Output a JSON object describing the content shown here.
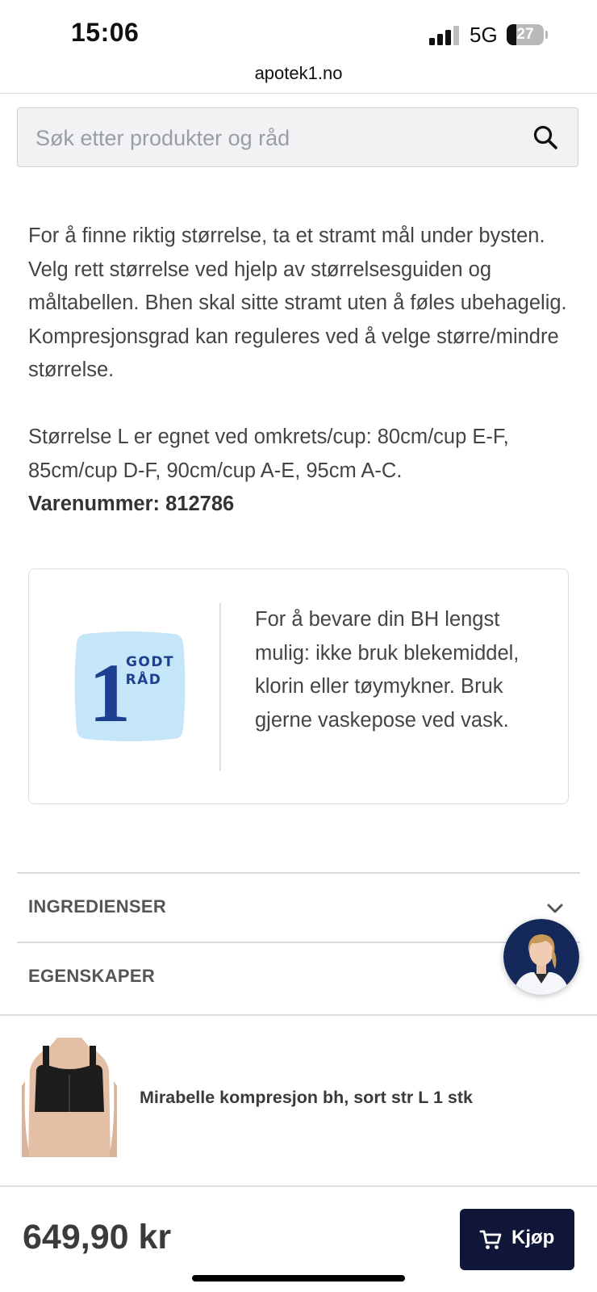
{
  "status_bar": {
    "time": "15:06",
    "network": "5G",
    "battery": "27",
    "battery_level": 0.27
  },
  "browser": {
    "url": "apotek1.no"
  },
  "search": {
    "placeholder": "Søk etter produkter og råd",
    "icon": "search-icon"
  },
  "description": {
    "paragraph1": "For å finne riktig størrelse, ta et stramt mål under bysten. Velg rett størrelse ved hjelp av størrelsesguiden og måltabellen. Bhen skal sitte stramt uten å føles ubehagelig. Kompresjonsgrad kan reguleres ved å velge større/mindre størrelse.",
    "paragraph2": " Størrelse L er egnet ved omkrets/cup: 80cm/cup E-F, 85cm/cup D-F, 90cm/cup A-E, 95cm A-C.",
    "item_number_label": "Varenummer:",
    "item_number": "812786"
  },
  "tip": {
    "badge_number": "1",
    "badge_line1": "GODT",
    "badge_line2": "RÅD",
    "text": "For å bevare din BH lengst mulig: ikke bruk blekemiddel, klorin eller tøymykner. Bruk gjerne vaskepose ved vask.",
    "badge_color": "#c5e5f8",
    "badge_text_color": "#1d3f8f"
  },
  "accordion": [
    {
      "label": "INGREDIENSER",
      "icon": "chevron-down-icon"
    },
    {
      "label": "EGENSKAPER"
    }
  ],
  "chat": {
    "icon": "pharmacist-avatar"
  },
  "product": {
    "name": "Mirabelle kompresjon bh, sort str L 1 stk"
  },
  "purchase": {
    "price": "649,90 kr",
    "buy_label": "Kjøp",
    "button_color": "#0f1638"
  }
}
